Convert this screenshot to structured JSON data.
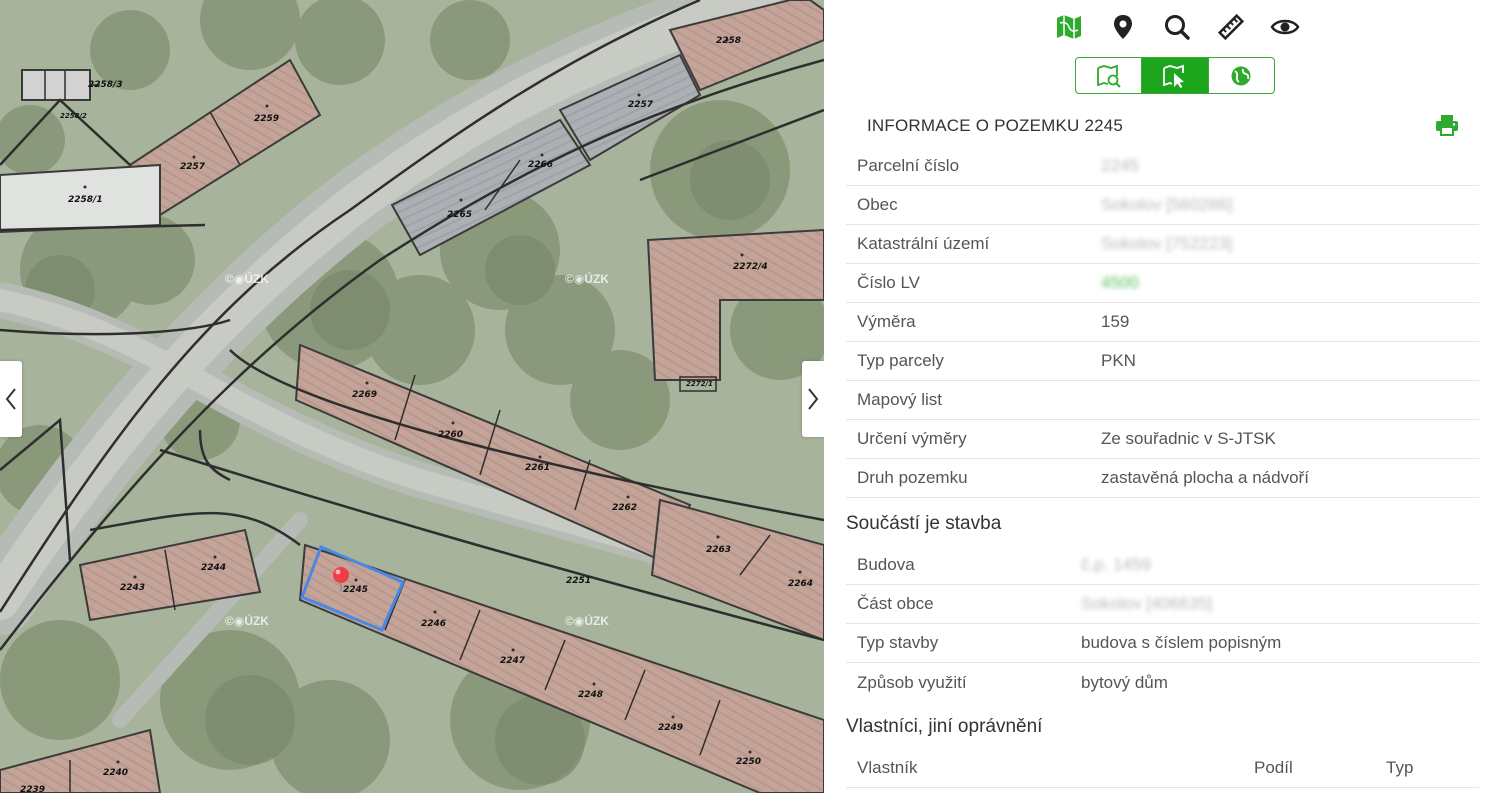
{
  "map": {
    "watermark": "ÚZK",
    "parcels": [
      "2258/3",
      "2258/2",
      "2259",
      "2257",
      "2258/1",
      "2258",
      "2257",
      "2265",
      "2266",
      "2272/4",
      "2272/1",
      "2269",
      "2260",
      "2261",
      "2262",
      "2263",
      "2264",
      "2251",
      "2243",
      "2244",
      "2245",
      "2246",
      "2247",
      "2248",
      "2249",
      "2250",
      "2240",
      "2239"
    ],
    "left_arrow": "chevron-left-icon",
    "right_arrow": "chevron-right-icon",
    "marker": "location-pin-icon"
  },
  "toolbar": {
    "icons": [
      "map-icon",
      "pin-icon",
      "search-icon",
      "measure-icon",
      "eye-icon"
    ],
    "active_color": "#2eaa2e"
  },
  "mode_tabs": {
    "icons": [
      "map-search-icon",
      "cursor-select-icon",
      "globe-icon"
    ],
    "active_index": 1
  },
  "info": {
    "title": "INFORMACE O POZEMKU 2245",
    "rows": [
      {
        "label": "Parcelní číslo",
        "value": "2245",
        "blurred": true
      },
      {
        "label": "Obec",
        "value": "Sokolov [560286]",
        "blurred": true
      },
      {
        "label": "Katastrální území",
        "value": "Sokolov [752223]",
        "blurred": true
      },
      {
        "label": "Číslo LV",
        "value": "4500",
        "blurred": true,
        "link": true
      },
      {
        "label": "Výměra",
        "value": "159",
        "blurred": false
      },
      {
        "label": "Typ parcely",
        "value": "PKN",
        "blurred": false
      },
      {
        "label": "Mapový list",
        "value": "",
        "blurred": false
      },
      {
        "label": "Určení výměry",
        "value": "Ze souřadnic v S-JTSK",
        "blurred": false
      },
      {
        "label": "Druh pozemku",
        "value": "zastavěná plocha a nádvoří",
        "blurred": false
      }
    ]
  },
  "building": {
    "title": "Součástí je stavba",
    "rows": [
      {
        "label": "Budova",
        "value": "č.p. 1459",
        "blurred": true
      },
      {
        "label": "Část obce",
        "value": "Sokolov [406635]",
        "blurred": true
      },
      {
        "label": "Typ stavby",
        "value": "budova s číslem popisným",
        "blurred": false
      },
      {
        "label": "Způsob využití",
        "value": "bytový dům",
        "blurred": false
      }
    ]
  },
  "owners": {
    "title": "Vlastníci, jiní oprávnění",
    "headers": {
      "owner": "Vlastník",
      "share": "Podíl",
      "type": "Typ"
    }
  }
}
